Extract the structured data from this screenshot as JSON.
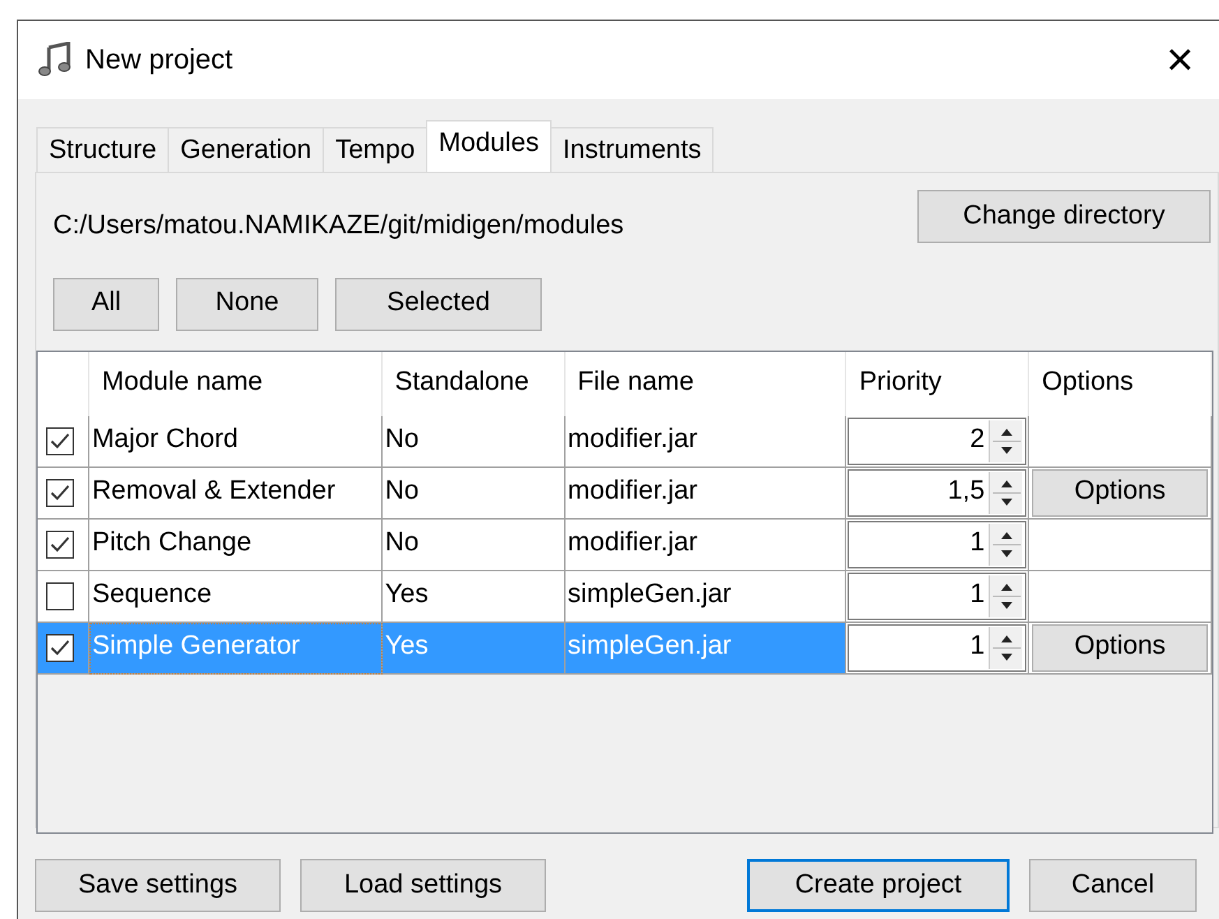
{
  "window": {
    "title": "New project",
    "close": "×"
  },
  "tabs": [
    {
      "label": "Structure",
      "selected": false
    },
    {
      "label": "Generation",
      "selected": false
    },
    {
      "label": "Tempo",
      "selected": false
    },
    {
      "label": "Modules",
      "selected": true
    },
    {
      "label": "Instruments",
      "selected": false
    }
  ],
  "directory": {
    "path": "C:/Users/matou.NAMIKAZE/git/midigen/modules",
    "button": "Change directory"
  },
  "filter_buttons": [
    "All",
    "None",
    "Selected"
  ],
  "table": {
    "columns": [
      "Module name",
      "Standalone",
      "File name",
      "Priority",
      "Options"
    ],
    "rows": [
      {
        "checked": true,
        "name": "Major Chord",
        "standalone": "No",
        "file": "modifier.jar",
        "priority": "2",
        "selected": false
      },
      {
        "checked": true,
        "name": "Removal & Extender",
        "standalone": "No",
        "file": "modifier.jar",
        "priority": "1,5",
        "options": "Options",
        "selected": false
      },
      {
        "checked": true,
        "name": "Pitch Change",
        "standalone": "No",
        "file": "modifier.jar",
        "priority": "1",
        "selected": false
      },
      {
        "checked": false,
        "name": "Sequence",
        "standalone": "Yes",
        "file": "simpleGen.jar",
        "priority": "1",
        "selected": false
      },
      {
        "checked": true,
        "name": "Simple Generator",
        "standalone": "Yes",
        "file": "simpleGen.jar",
        "priority": "1",
        "options": "Options",
        "selected": true
      }
    ]
  },
  "footer": {
    "left_buttons": [
      "Save settings",
      "Load settings"
    ],
    "right_buttons": [
      {
        "label": "Create project",
        "default": true
      },
      {
        "label": "Cancel",
        "default": false
      }
    ]
  }
}
